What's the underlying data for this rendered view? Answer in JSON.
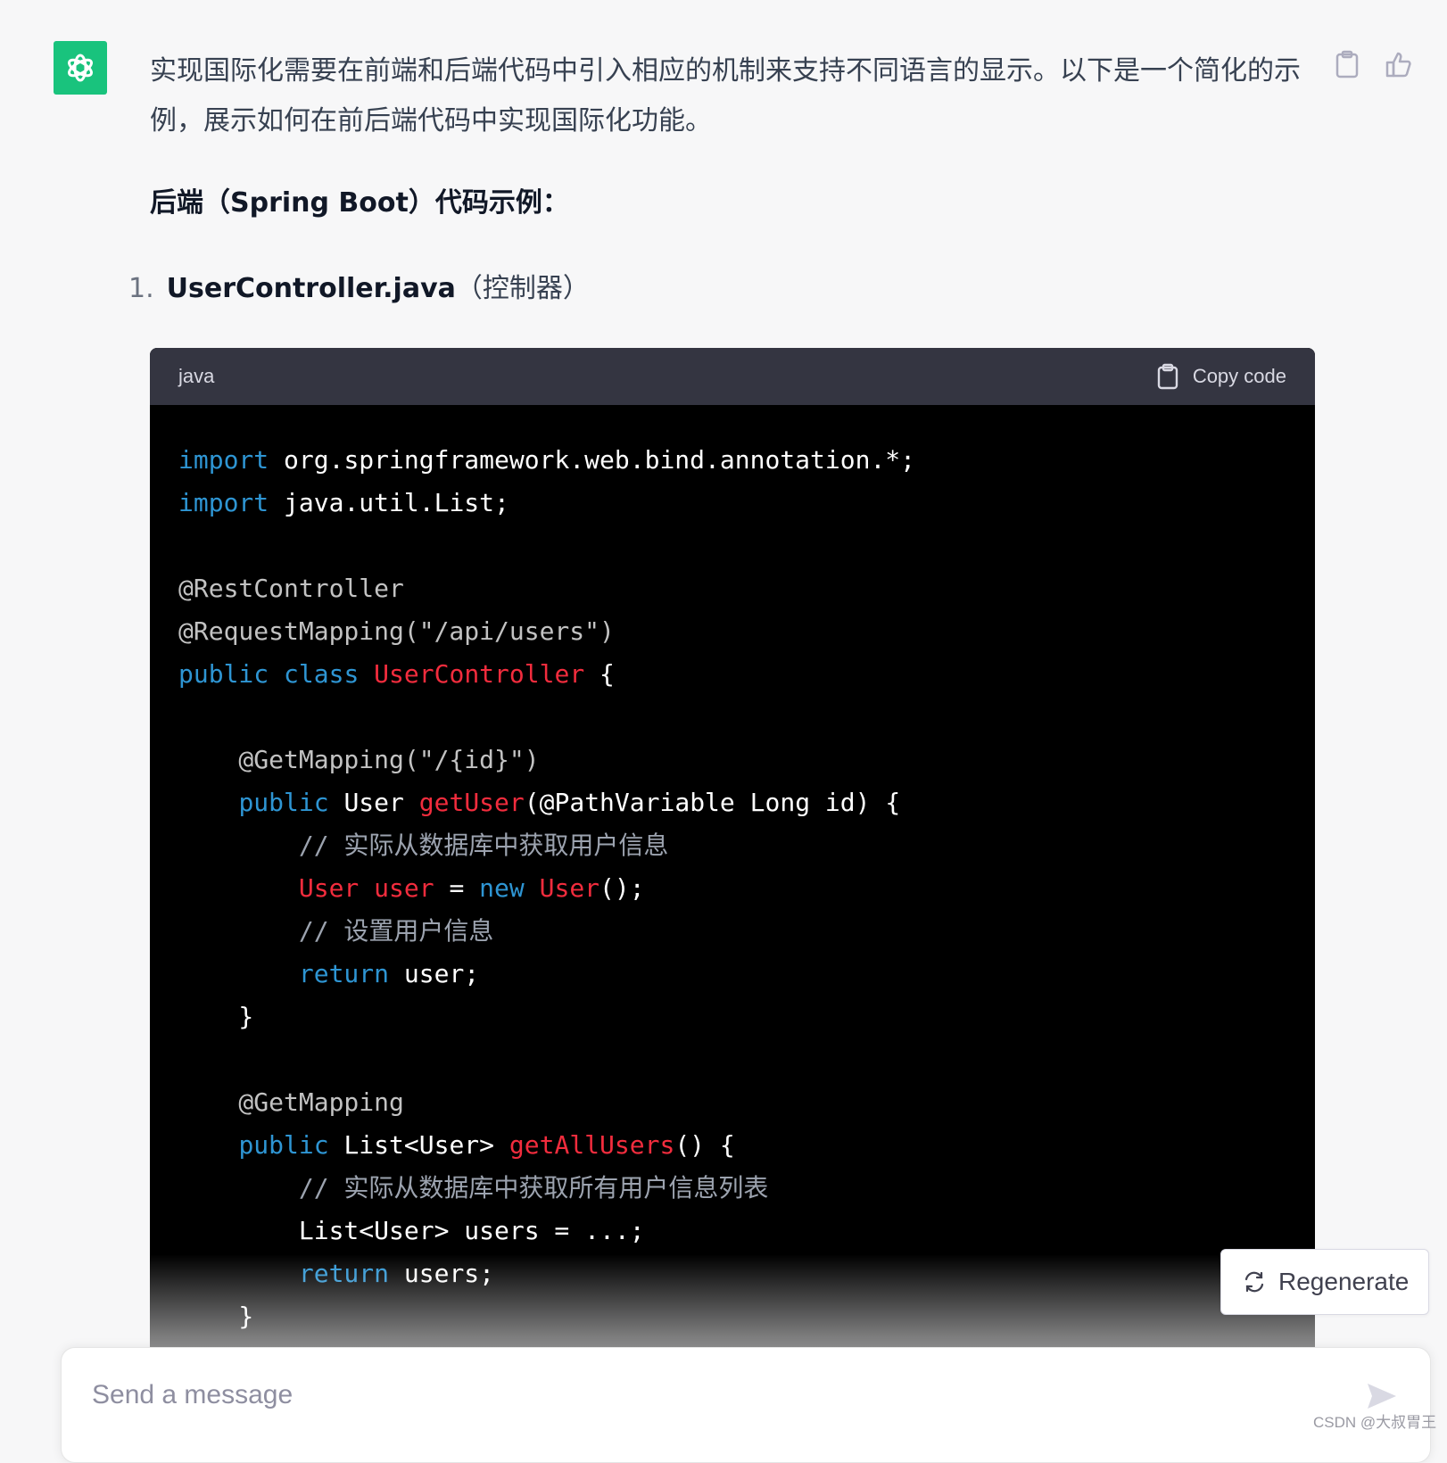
{
  "message": {
    "intro": "实现国际化需要在前端和后端代码中引入相应的机制来支持不同语言的显示。以下是一个简化的示例，展示如何在前后端代码中实现国际化功能。",
    "heading": "后端（Spring Boot）代码示例：",
    "list_item": {
      "number": "1.",
      "file": "UserController.java",
      "desc": "（控制器）"
    }
  },
  "code_block": {
    "language": "java",
    "copy_label": "Copy code",
    "lines": {
      "l1_kw": "import",
      "l1_rest": " org.springframework.web.bind.annotation.*;",
      "l2_kw": "import",
      "l2_rest": " java.util.List;",
      "l4": "@RestController",
      "l5": "@RequestMapping(\"/api/users\")",
      "l6_kw1": "public",
      "l6_kw2": "class",
      "l6_cls": "UserController",
      "l6_rest": " {",
      "l8": "    @GetMapping(\"/{id}\")",
      "l9_indent": "    ",
      "l9_kw": "public",
      "l9_type": " User ",
      "l9_fn": "getUser",
      "l9_rest": "(@PathVariable Long id) {",
      "l10": "        // 实际从数据库中获取用户信息",
      "l11_indent": "        ",
      "l11_type": "User",
      "l11_var": "user",
      "l11_eq": " = ",
      "l11_new": "new",
      "l11_cls": "User",
      "l11_rest": "();",
      "l12": "        // 设置用户信息",
      "l13_indent": "        ",
      "l13_kw": "return",
      "l13_rest": " user;",
      "l14": "    }",
      "l16": "    @GetMapping",
      "l17_indent": "    ",
      "l17_kw": "public",
      "l17_type": " List<User> ",
      "l17_fn": "getAllUsers",
      "l17_rest": "() {",
      "l18": "        // 实际从数据库中获取所有用户信息列表",
      "l19": "        List<User> users = ...;",
      "l20_indent": "        ",
      "l20_kw": "return",
      "l20_rest": " users;",
      "l21": "    }"
    }
  },
  "regenerate_label": "Regenerate",
  "composer": {
    "placeholder": "Send a message"
  },
  "watermark": "CSDN @大叔胃王",
  "colors": {
    "brand": "#19c37d",
    "keyword": "#2e95d3",
    "class": "#f22c3d"
  },
  "icons": [
    "openai-logo-icon",
    "clipboard-icon",
    "thumbs-up-icon",
    "refresh-icon",
    "send-icon"
  ]
}
